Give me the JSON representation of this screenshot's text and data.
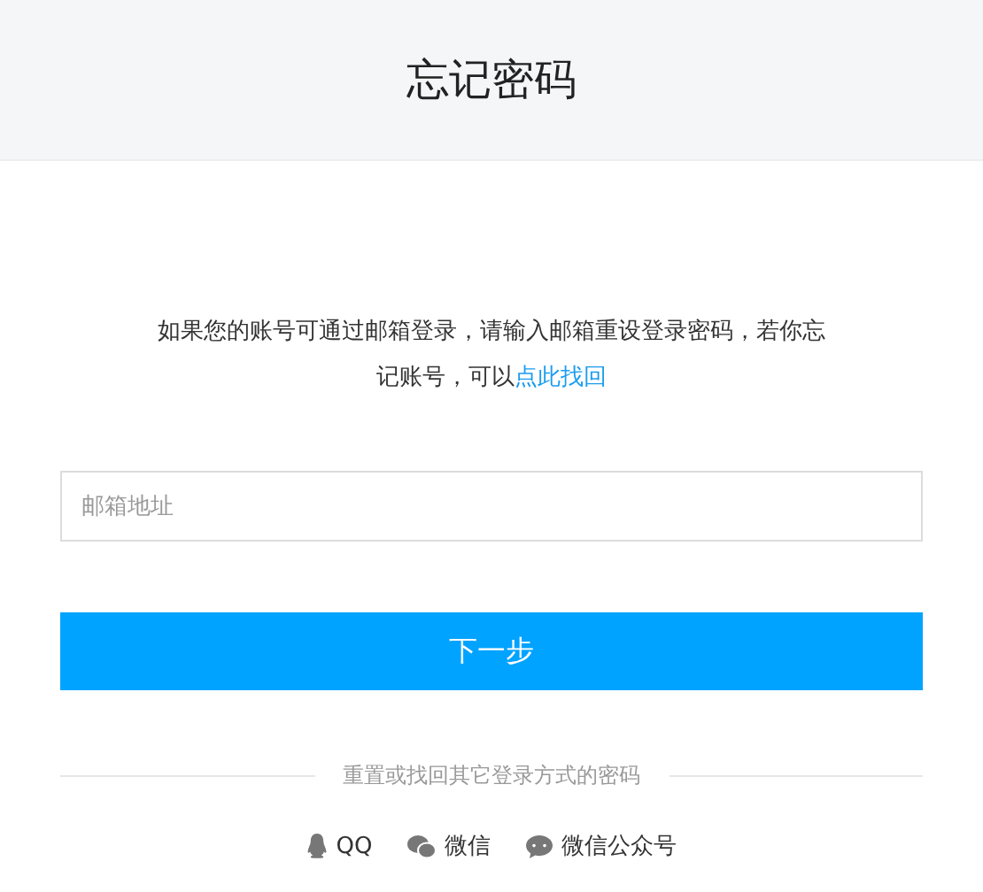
{
  "header": {
    "title": "忘记密码"
  },
  "intro": {
    "text": "如果您的账号可通过邮箱登录，请输入邮箱重设登录密码，若你忘记账号，可以",
    "link": "点此找回"
  },
  "email_field": {
    "placeholder": "邮箱地址"
  },
  "next_button": "下一步",
  "divider_label": "重置或找回其它登录方式的密码",
  "methods": [
    {
      "kind": "qq",
      "label": "QQ"
    },
    {
      "kind": "wechat",
      "label": "微信"
    },
    {
      "kind": "official",
      "label": "微信公众号"
    }
  ]
}
